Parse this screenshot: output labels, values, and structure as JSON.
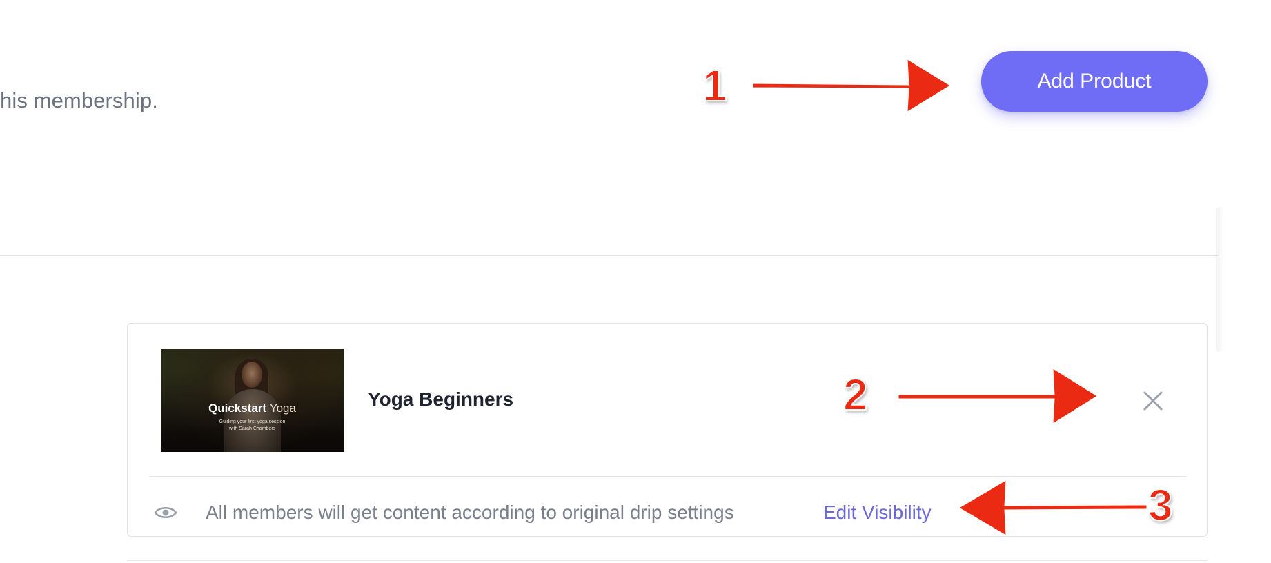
{
  "header": {
    "description": "his membership.",
    "add_product_label": "Add Product"
  },
  "product": {
    "name": "Yoga Beginners",
    "thumbnail": {
      "title_main": "Quickstart",
      "title_accent": "Yoga",
      "subtitle_line1": "Guiding your first yoga session",
      "subtitle_line2": "with Sarah Chambers"
    },
    "visibility_text": "All members will get content according to original drip settings",
    "edit_visibility_label": "Edit Visibility",
    "remove_icon": "close-icon",
    "visibility_icon": "eye-icon"
  },
  "annotations": [
    {
      "number": "1"
    },
    {
      "number": "2"
    },
    {
      "number": "3"
    }
  ],
  "colors": {
    "accent": "#6f6cf6",
    "link": "#6c68d8",
    "annotation": "#ea2a12",
    "muted_text": "#7a7f8c"
  }
}
